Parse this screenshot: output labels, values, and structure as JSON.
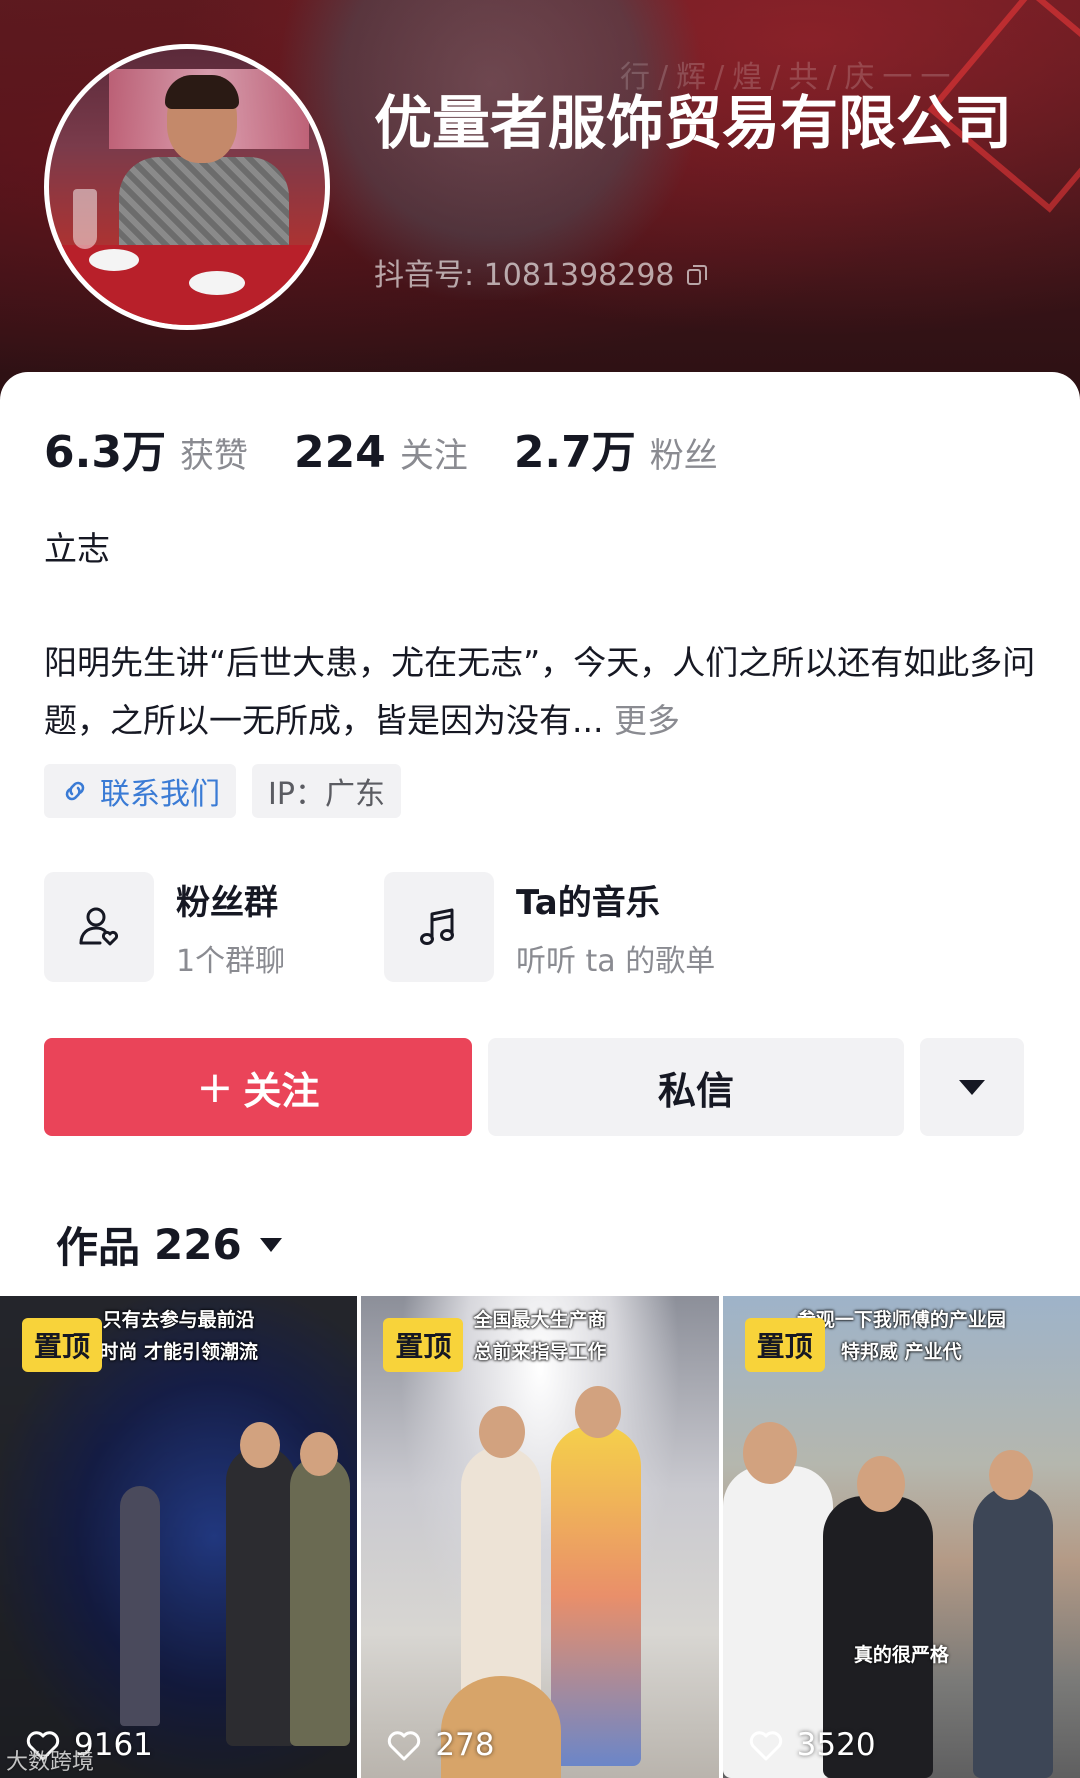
{
  "profile": {
    "name": "优量者服饰贸易有限公司",
    "douyin_id": "抖音号: 1081398298",
    "banner_text": "行/辉/煌/共/庆一一"
  },
  "stats": [
    {
      "value": "6.3万",
      "label": "获赞"
    },
    {
      "value": "224",
      "label": "关注"
    },
    {
      "value": "2.7万",
      "label": "粉丝"
    }
  ],
  "bio": {
    "title": "立志",
    "text": "阳明先生讲“后世大患，尤在无志”，今天，人们之所以还有如此多问题，之所以一无所成，皆是因为没有...",
    "more": "更多"
  },
  "tags": {
    "contact": "联系我们",
    "ip": "IP：广东"
  },
  "features": [
    {
      "title": "粉丝群",
      "subtitle": "1个群聊",
      "icon": "fans-group-icon"
    },
    {
      "title": "Ta的音乐",
      "subtitle": "听听 ta 的歌单",
      "icon": "music-note-icon"
    }
  ],
  "actions": {
    "follow_plus": "+",
    "follow": "关注",
    "message": "私信"
  },
  "works": {
    "label": "作品",
    "count": "226"
  },
  "videos": [
    {
      "pin": "置顶",
      "caption_line1": "只有去参与最前沿",
      "caption_line2": "时尚 才能引领潮流",
      "mid_caption": "",
      "likes": "9161"
    },
    {
      "pin": "置顶",
      "caption_line1": "全国最大生产商",
      "caption_line2": "总前来指导工作",
      "mid_caption": "",
      "likes": "278"
    },
    {
      "pin": "置顶",
      "caption_line1": "参观一下我师傅的产业园",
      "caption_line2": "特邦威 产业代",
      "mid_caption": "真的很严格",
      "likes": "3520"
    }
  ],
  "watermark": "大数跨境",
  "colors": {
    "follow_button": "#ea4459",
    "pin_badge": "#f8d33a",
    "link_blue": "#3a7bd5"
  }
}
